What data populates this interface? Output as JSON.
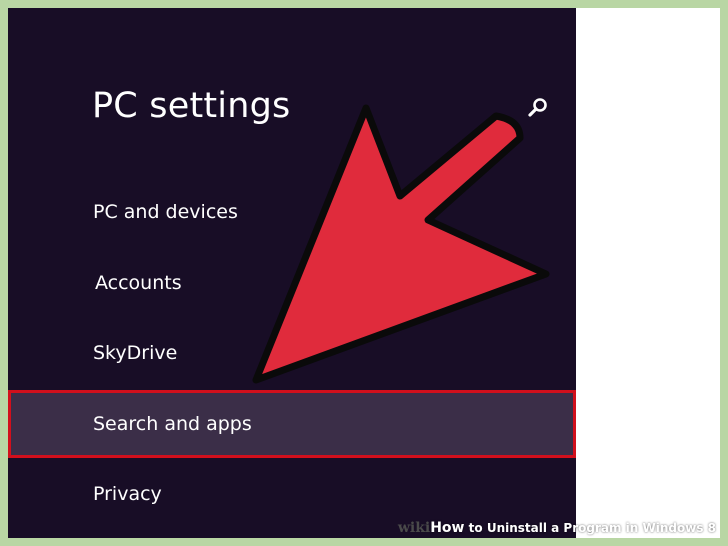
{
  "settings": {
    "title": "PC settings",
    "search_icon": "search-icon"
  },
  "nav": {
    "items": [
      {
        "label": "PC and devices"
      },
      {
        "label": "Accounts"
      },
      {
        "label": "SkyDrive"
      },
      {
        "label": "Search and apps",
        "selected": true
      },
      {
        "label": "Privacy"
      }
    ]
  },
  "colors": {
    "panel_background": "#180d26",
    "selected_item_background": "#3b2e48",
    "highlight_border": "#d10f1c",
    "arrow_fill": "#e02b3c",
    "outer_border": "#b9d6a4"
  },
  "watermark": {
    "wiki": "wiki",
    "how": "How",
    "text": " to Uninstall a Program in Windows 8"
  }
}
